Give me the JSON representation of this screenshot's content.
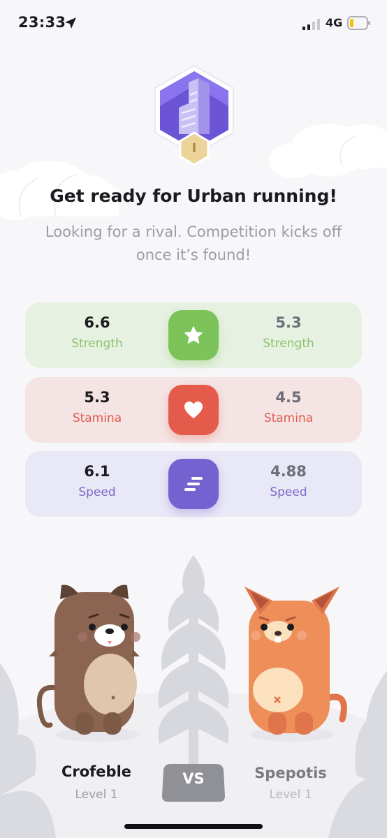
{
  "status_bar": {
    "time": "23:33",
    "network": "4G",
    "icons": [
      "location-arrow-icon",
      "signal-bars-icon",
      "battery-icon"
    ]
  },
  "badge": {
    "roman_numeral": "I",
    "icon": "skyscraper-badge-icon"
  },
  "header": {
    "title": "Get ready for Urban running!",
    "subtitle": "Looking for a rival. Competition kicks off once it’s found!"
  },
  "stats": [
    {
      "key": "strength",
      "label": "Strength",
      "player_value": "6.6",
      "rival_value": "5.3",
      "icon": "star-icon",
      "color": "#7cc35a"
    },
    {
      "key": "stamina",
      "label": "Stamina",
      "player_value": "5.3",
      "rival_value": "4.5",
      "icon": "heart-icon",
      "color": "#e45b4b"
    },
    {
      "key": "speed",
      "label": "Speed",
      "player_value": "6.1",
      "rival_value": "4.88",
      "icon": "speed-lines-icon",
      "color": "#7462d0"
    }
  ],
  "player": {
    "name": "Crofeble",
    "level": "Level 1",
    "avatar": "brown-bear-character"
  },
  "rival": {
    "name": "Spepotis",
    "level": "Level 1",
    "avatar": "orange-fox-character"
  },
  "vs_label": "VS"
}
